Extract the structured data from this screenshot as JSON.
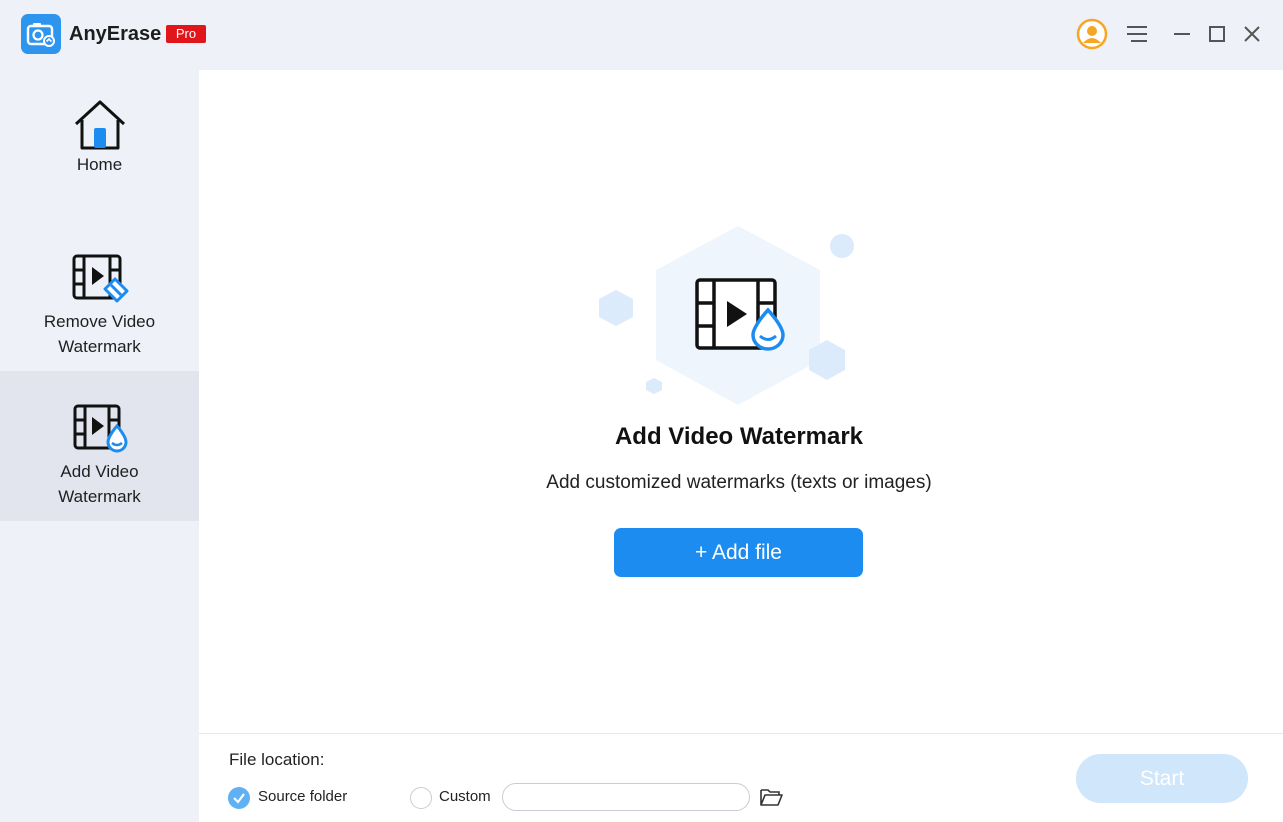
{
  "app": {
    "name": "AnyErase",
    "badge": "Pro"
  },
  "colors": {
    "accent": "#1d8cf0",
    "badge": "#e0161a",
    "avatar": "#f5a623"
  },
  "titlebar_icons": [
    "account-icon",
    "menu-icon",
    "minimize-icon",
    "maximize-icon",
    "close-icon"
  ],
  "sidebar": {
    "items": [
      {
        "label": "Home",
        "icon": "home-icon"
      },
      {
        "label": "Remove Video\nWatermark",
        "icon": "remove-video-watermark-icon"
      },
      {
        "label": "Add Video\nWatermark",
        "icon": "add-video-watermark-icon",
        "active": true
      }
    ]
  },
  "main": {
    "title": "Add Video Watermark",
    "subtitle": "Add customized watermarks (texts or images)",
    "add_button": "+ Add file"
  },
  "footer": {
    "location_label": "File location:",
    "source_option": "Source folder",
    "custom_option": "Custom",
    "custom_path": "",
    "start_button": "Start"
  }
}
